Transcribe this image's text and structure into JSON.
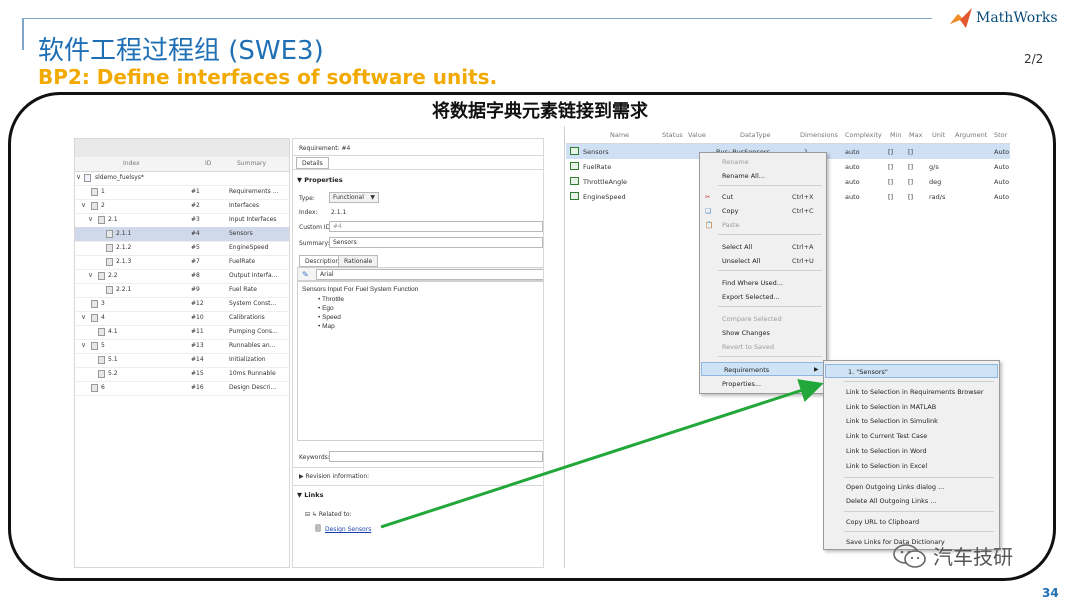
{
  "slide": {
    "title": "软件工程过程组 (SWE3)",
    "subtitle": "BP2: Define interfaces of software units.",
    "page_indicator": "2/2",
    "caption": "将数据字典元素链接到需求",
    "slide_number": "34",
    "logo_text": "MathWorks",
    "watermark": "汽车技研"
  },
  "colors": {
    "accent": "#1f6fb5",
    "subtitle": "#f2a900",
    "arrow": "#22a83a",
    "selection": "#cfd9ea"
  },
  "tree": {
    "headers": {
      "index": "Index",
      "id": "ID",
      "summary": "Summary"
    },
    "root": "sldemo_fuelsys*",
    "rows": [
      {
        "index": "1",
        "id": "#1",
        "summary": "Requirements ..."
      },
      {
        "index": "2",
        "id": "#2",
        "summary": "Interfaces"
      },
      {
        "index": "2.1",
        "id": "#3",
        "summary": "Input Interfaces"
      },
      {
        "index": "2.1.1",
        "id": "#4",
        "summary": "Sensors"
      },
      {
        "index": "2.1.2",
        "id": "#5",
        "summary": "EngineSpeed"
      },
      {
        "index": "2.1.3",
        "id": "#7",
        "summary": "FuelRate"
      },
      {
        "index": "2.2",
        "id": "#8",
        "summary": "Output Interfa..."
      },
      {
        "index": "2.2.1",
        "id": "#9",
        "summary": "Fuel Rate"
      },
      {
        "index": "3",
        "id": "#12",
        "summary": "System Const..."
      },
      {
        "index": "4",
        "id": "#10",
        "summary": "Calibrations"
      },
      {
        "index": "4.1",
        "id": "#11",
        "summary": "Pumping Cons..."
      },
      {
        "index": "5",
        "id": "#13",
        "summary": "Runnables an..."
      },
      {
        "index": "5.1",
        "id": "#14",
        "summary": "Initialization"
      },
      {
        "index": "5.2",
        "id": "#15",
        "summary": "10ms Runnable"
      },
      {
        "index": "6",
        "id": "#16",
        "summary": "Design Descri..."
      }
    ]
  },
  "details": {
    "requirement": "Requirement: #4",
    "tab": "Details",
    "properties_label": "Properties",
    "type_label": "Type:",
    "type_value": "Functional",
    "index_label": "Index:",
    "index_value": "2.1.1",
    "custom_id_label": "Custom ID:",
    "custom_id_value": "#4",
    "summary_label": "Summary:",
    "summary_value": "Sensors",
    "tab_description": "Description",
    "tab_rationale": "Rationale",
    "font": "Arial",
    "desc_line": "Sensors Input For Fuel System Function",
    "bullets": [
      "Throttle",
      "Ego",
      "Speed",
      "Map"
    ],
    "keywords_label": "Keywords:",
    "revision_label": "Revision information:",
    "links_label": "Links",
    "related_label": "Related to:",
    "link_text": "Design Sensors"
  },
  "dictionary": {
    "headers": [
      "Name",
      "Status",
      "Value",
      "DataType",
      "Dimensions",
      "Complexity",
      "Min",
      "Max",
      "Unit",
      "Argument",
      "Stor"
    ],
    "rows": [
      {
        "name": "Sensors",
        "datatype": "Bus: BusSensors",
        "dims": "1",
        "complexity": "auto",
        "min": "[]",
        "max": "[]",
        "unit": "",
        "stor": "Auto"
      },
      {
        "name": "FuelRate",
        "datatype": "",
        "dims": "",
        "complexity": "auto",
        "min": "[]",
        "max": "[]",
        "unit": "g/s",
        "stor": "Auto"
      },
      {
        "name": "ThrottleAngle",
        "datatype": "",
        "dims": "",
        "complexity": "auto",
        "min": "[]",
        "max": "[]",
        "unit": "deg",
        "stor": "Auto"
      },
      {
        "name": "EngineSpeed",
        "datatype": "",
        "dims": "",
        "complexity": "auto",
        "min": "[]",
        "max": "[]",
        "unit": "rad/s",
        "stor": "Auto"
      }
    ]
  },
  "context_menu": {
    "rename": "Rename",
    "rename_all": "Rename All...",
    "cut": "Cut",
    "cut_sc": "Ctrl+X",
    "copy": "Copy",
    "copy_sc": "Ctrl+C",
    "paste": "Paste",
    "select_all": "Select All",
    "select_all_sc": "Ctrl+A",
    "unselect_all": "Unselect All",
    "unselect_all_sc": "Ctrl+U",
    "find_where": "Find Where Used...",
    "export": "Export Selected...",
    "compare": "Compare Selected",
    "show_changes": "Show Changes",
    "revert": "Revert to Saved",
    "requirements": "Requirements",
    "properties": "Properties..."
  },
  "submenu": {
    "item1": "1. \"Sensors\"",
    "link_rb": "Link to Selection in Requirements Browser",
    "link_matlab": "Link to Selection in MATLAB",
    "link_simulink": "Link to Selection in Simulink",
    "link_test": "Link to Current Test Case",
    "link_word": "Link to Selection in Word",
    "link_excel": "Link to Selection in Excel",
    "open_outgoing": "Open Outgoing Links dialog ...",
    "delete_outgoing": "Delete All Outgoing Links ...",
    "copy_url": "Copy URL to Clipboard",
    "save_links": "Save Links for Data Dictionary"
  }
}
